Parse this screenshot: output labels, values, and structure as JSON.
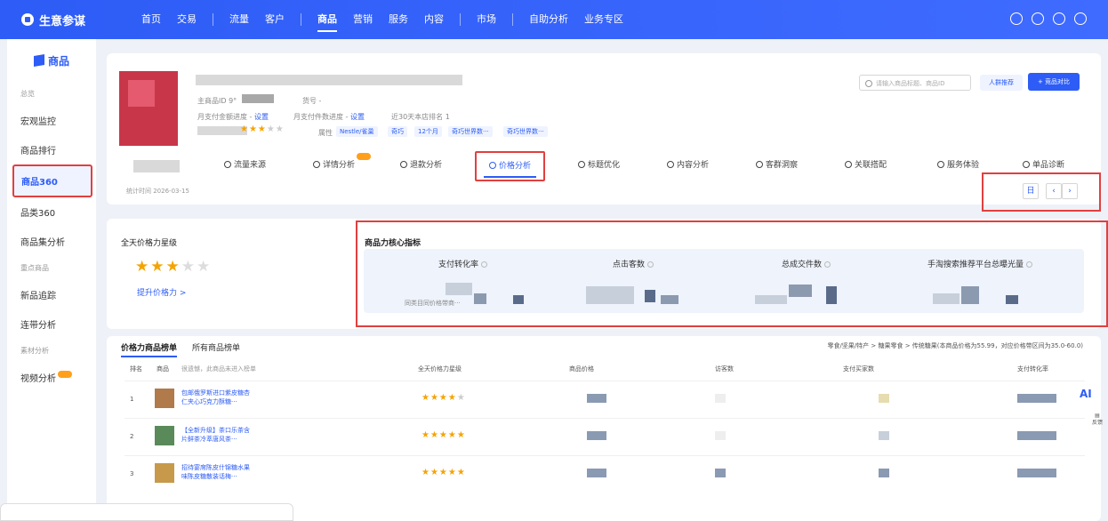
{
  "app": {
    "name": "生意参谋"
  },
  "nav": {
    "items": [
      "首页",
      "交易",
      "流量",
      "客户",
      "商品",
      "营销",
      "服务",
      "内容",
      "市场",
      "自助分析",
      "业务专区"
    ],
    "active_index": 4
  },
  "sidebar": {
    "title": "商品",
    "groups": [
      {
        "label": "总览",
        "items": [
          "宏观监控",
          "商品排行",
          "商品360",
          "品类360",
          "商品集分析"
        ]
      },
      {
        "label": "重点商品",
        "items": [
          "新品追踪",
          "连带分析"
        ]
      },
      {
        "label": "素材分析",
        "items": [
          "视频分析"
        ]
      }
    ],
    "active_item": "商品360"
  },
  "product": {
    "id_label": "主商品ID",
    "id_prefix": "9°",
    "code_label": "货号",
    "pay_amount_label": "月支付金额进度",
    "pay_amount_link": "设置",
    "pay_count_label": "月支付件数进度",
    "pay_count_link": "设置",
    "rank_label": "近30天本店排名",
    "rank_value": "1",
    "attr_label": "属性",
    "attr_tags": [
      "Nestle/雀巢",
      "奇巧",
      "12个月",
      "奇巧世界数···",
      "奇巧世界数···"
    ]
  },
  "header": {
    "search_placeholder": "请输入商品标题、商品ID",
    "crowd_btn": "人群推荐",
    "compare_btn": "+ 竞品对比"
  },
  "tabs": [
    "流量来源",
    "详情分析",
    "退款分析",
    "价格分析",
    "标题优化",
    "内容分析",
    "客群洞察",
    "关联搭配",
    "服务体验",
    "单品诊断"
  ],
  "active_tab": "价格分析",
  "stat_time": "统计时间 2026-03-15",
  "price_level": {
    "title": "全天价格力星级",
    "stars": 3,
    "max_stars": 5,
    "link": "提升价格力 >"
  },
  "core_metrics": {
    "title": "商品力核心指标",
    "metrics": [
      "支付转化率",
      "点击客数",
      "总成交件数",
      "手淘搜索推荐平台总曝光量"
    ],
    "note": "同类目同价格带商···"
  },
  "list": {
    "tabs": [
      "价格力商品榜单",
      "所有商品榜单"
    ],
    "breadcrumb": "零食/坚果/特产 > 糖果零食 > 传统糖果(本商品价格为55.99，对应价格带区间为35.0-60.0)",
    "headers": [
      "排名",
      "商品",
      "很遗憾，此商品未进入榜单",
      "全天价格力星级",
      "商品价格",
      "访客数",
      "支付买家数",
      "支付转化率"
    ],
    "rows": [
      {
        "rank": "1",
        "name": "包邮俄罗斯进口紫皮糖杏仁夹心巧克力酥糖···",
        "stars": 4
      },
      {
        "rank": "2",
        "name": "【全新升级】茶口乐茶含片鲜茶冷萃唐风茶···",
        "stars": 5
      },
      {
        "rank": "3",
        "name": "招待宴席陈皮什锦糖水果味陈皮糖散装话梅···",
        "stars": 5
      }
    ]
  },
  "side_tools": {
    "ai": "AI",
    "feedback": "反馈"
  }
}
